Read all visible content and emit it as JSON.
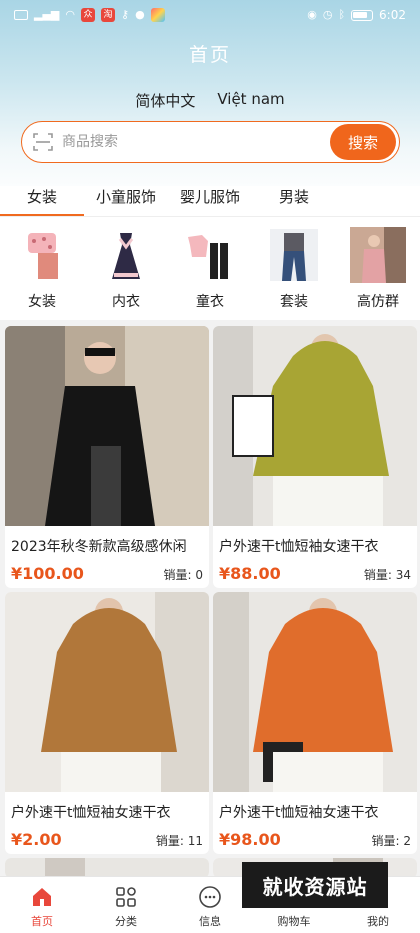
{
  "status_bar": {
    "time": "6:02",
    "left_icons": [
      "hd-icon",
      "signal-icon",
      "wifi-icon",
      "app-icon",
      "news-icon",
      "key-icon",
      "chat-icon",
      "plus-icon"
    ],
    "right_icons": [
      "eye-icon",
      "alarm-icon",
      "bluetooth-icon",
      "battery-icon"
    ]
  },
  "header": {
    "title": "首页"
  },
  "languages": [
    "简体中文",
    "Việt nam"
  ],
  "search": {
    "placeholder": "商品搜索",
    "button_label": "搜索"
  },
  "tabs": [
    "女装",
    "小童服饰",
    "婴儿服饰",
    "男装"
  ],
  "categories": [
    {
      "label": "女装"
    },
    {
      "label": "内衣"
    },
    {
      "label": "童衣"
    },
    {
      "label": "套装"
    },
    {
      "label": "高仿群"
    }
  ],
  "products": [
    {
      "title": "2023年秋冬新款高级感休闲",
      "price": "¥100.00",
      "sales": "销量: 0",
      "color": "#2a2a2a"
    },
    {
      "title": "户外速干t恤短袖女速干衣",
      "price": "¥88.00",
      "sales": "销量: 34",
      "color": "#a8a534"
    },
    {
      "title": "户外速干t恤短袖女速干衣",
      "price": "¥2.00",
      "sales": "销量: 11",
      "color": "#b1773a"
    },
    {
      "title": "户外速干t恤短袖女速干衣",
      "price": "¥98.00",
      "sales": "销量: 2",
      "color": "#e06d2c"
    }
  ],
  "bottom_nav": [
    {
      "label": "首页",
      "icon": "home-icon"
    },
    {
      "label": "分类",
      "icon": "grid-icon"
    },
    {
      "label": "信息",
      "icon": "message-icon"
    },
    {
      "label": "购物车",
      "icon": "cart-icon"
    },
    {
      "label": "我的",
      "icon": "user-icon"
    }
  ],
  "watermark": "就收资源站",
  "colors": {
    "accent": "#f0661c",
    "price": "#e8561c",
    "active_nav": "#e8473b"
  }
}
